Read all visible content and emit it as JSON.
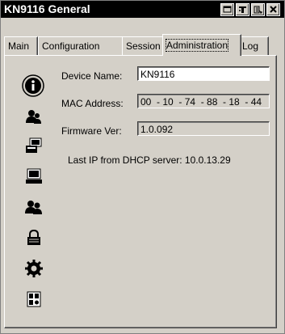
{
  "window": {
    "title": "KN9116 General",
    "buttons": [
      "minimize",
      "help",
      "export",
      "close"
    ]
  },
  "tabs": [
    {
      "label": "Main",
      "active": false
    },
    {
      "label": "Configuration",
      "active": false
    },
    {
      "label": "Session",
      "active": false
    },
    {
      "label": "Administration",
      "active": true
    },
    {
      "label": "Log",
      "active": false
    }
  ],
  "sidebar_icons": [
    "info-icon",
    "user-icon",
    "device-icon",
    "computer-icon",
    "users-icon",
    "lock-icon",
    "gear-icon",
    "firmware-icon"
  ],
  "fields": {
    "device_name": {
      "label": "Device Name:",
      "value": "KN9116"
    },
    "mac_address": {
      "label": "MAC Address:",
      "value": "00  - 10  - 74  - 88  - 18  - 44"
    },
    "firmware": {
      "label": "Firmware Ver:",
      "value": "1.0.092"
    }
  },
  "dhcp_info": "Last IP from DHCP server: 10.0.13.29"
}
